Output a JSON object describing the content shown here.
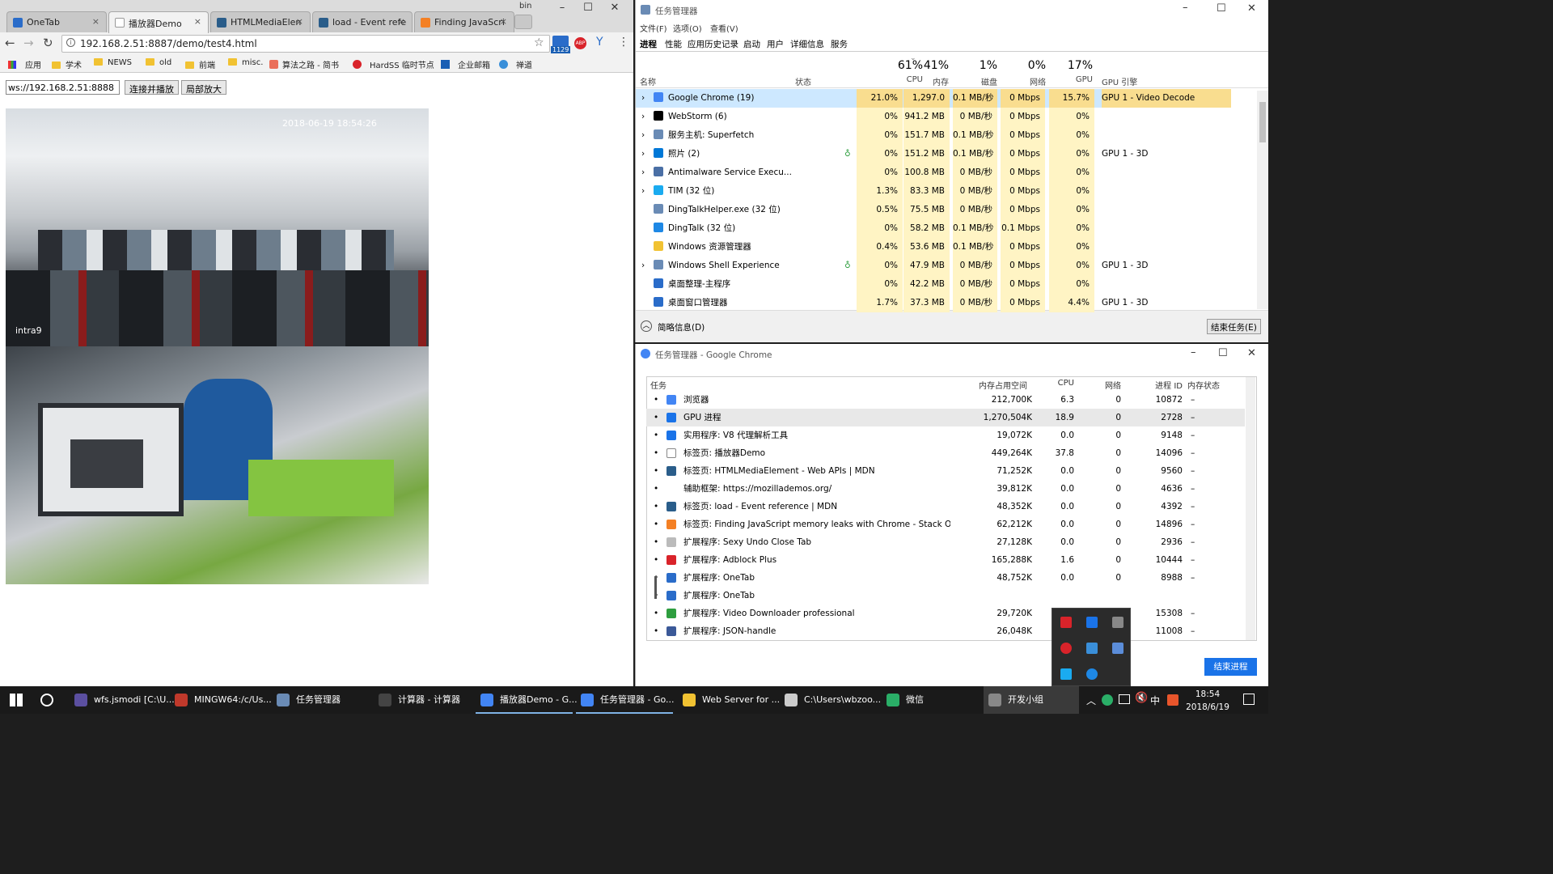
{
  "chrome": {
    "tabs": [
      {
        "label": "OneTab",
        "color": "#2a6cc9",
        "active": false
      },
      {
        "label": "播放器Demo",
        "color": "#ffffff",
        "active": true
      },
      {
        "label": "HTMLMediaElen",
        "color": "#2a5d8a",
        "active": false
      },
      {
        "label": "load - Event refe",
        "color": "#2a5d8a",
        "active": false
      },
      {
        "label": "Finding JavaScri",
        "color": "#f48024",
        "active": false
      }
    ],
    "profile_label": "bin",
    "address": "192.168.2.51:8887/demo/test4.html",
    "ext_badge": "1129",
    "bookmarks": [
      "应用",
      "学术",
      "NEWS",
      "old",
      "前端",
      "misc.",
      "算法之路 - 简书",
      "HardSS 临时节点",
      "企业邮箱",
      "禅道"
    ]
  },
  "page": {
    "ws_value": "ws://192.168.2.51:8888",
    "connect_button": "连接并播放",
    "zoom_button": "局部放大",
    "video_timestamp": "2018-06-19 18:54:26",
    "video_label": "intra9"
  },
  "taskmgr": {
    "title": "任务管理器",
    "menu": [
      "文件(F)",
      "选项(O)",
      "查看(V)"
    ],
    "tabs": [
      "进程",
      "性能",
      "应用历史记录",
      "启动",
      "用户",
      "详细信息",
      "服务"
    ],
    "summary": {
      "cpu": "61%",
      "mem": "41%",
      "disk": "1%",
      "net": "0%",
      "gpu": "17%"
    },
    "headers": {
      "name": "名称",
      "status": "状态",
      "cpu": "CPU",
      "mem": "内存",
      "disk": "磁盘",
      "net": "网络",
      "gpu": "GPU",
      "engine": "GPU 引擎"
    },
    "rows": [
      {
        "name": "Google Chrome (19)",
        "cpu": "21.0%",
        "mem": "1,297.0",
        "disk": "0.1 MB/秒",
        "net": "0 Mbps",
        "gpu": "15.7%",
        "engine": "GPU 1 - Video Decode",
        "color": "#4285f4",
        "expand": true,
        "leaf": false
      },
      {
        "name": "WebStorm (6)",
        "cpu": "0%",
        "mem": "941.2 MB",
        "disk": "0 MB/秒",
        "net": "0 Mbps",
        "gpu": "0%",
        "engine": "",
        "color": "#000000",
        "expand": true,
        "leaf": false
      },
      {
        "name": "服务主机: Superfetch",
        "cpu": "0%",
        "mem": "151.7 MB",
        "disk": "0.1 MB/秒",
        "net": "0 Mbps",
        "gpu": "0%",
        "engine": "",
        "color": "#6a8bb5",
        "expand": true,
        "leaf": false
      },
      {
        "name": "照片 (2)",
        "cpu": "0%",
        "mem": "151.2 MB",
        "disk": "0.1 MB/秒",
        "net": "0 Mbps",
        "gpu": "0%",
        "engine": "GPU 1 - 3D",
        "color": "#0078d7",
        "expand": true,
        "leaf": true
      },
      {
        "name": "Antimalware Service Execu...",
        "cpu": "0%",
        "mem": "100.8 MB",
        "disk": "0 MB/秒",
        "net": "0 Mbps",
        "gpu": "0%",
        "engine": "",
        "color": "#4a6fa5",
        "expand": true,
        "leaf": false
      },
      {
        "name": "TIM (32 位)",
        "cpu": "1.3%",
        "mem": "83.3 MB",
        "disk": "0 MB/秒",
        "net": "0 Mbps",
        "gpu": "0%",
        "engine": "",
        "color": "#1aabf0",
        "expand": true,
        "leaf": false
      },
      {
        "name": "DingTalkHelper.exe (32 位)",
        "cpu": "0.5%",
        "mem": "75.5 MB",
        "disk": "0 MB/秒",
        "net": "0 Mbps",
        "gpu": "0%",
        "engine": "",
        "color": "#6a8bb5",
        "expand": false,
        "leaf": false
      },
      {
        "name": "DingTalk (32 位)",
        "cpu": "0%",
        "mem": "58.2 MB",
        "disk": "0.1 MB/秒",
        "net": "0.1 Mbps",
        "gpu": "0%",
        "engine": "",
        "color": "#1e88e5",
        "expand": false,
        "leaf": false
      },
      {
        "name": "Windows 资源管理器",
        "cpu": "0.4%",
        "mem": "53.6 MB",
        "disk": "0.1 MB/秒",
        "net": "0 Mbps",
        "gpu": "0%",
        "engine": "",
        "color": "#f1c232",
        "expand": false,
        "leaf": false
      },
      {
        "name": "Windows Shell Experience",
        "cpu": "0%",
        "mem": "47.9 MB",
        "disk": "0 MB/秒",
        "net": "0 Mbps",
        "gpu": "0%",
        "engine": "GPU 1 - 3D",
        "color": "#6a8bb5",
        "expand": true,
        "leaf": true
      },
      {
        "name": "桌面整理-主程序",
        "cpu": "0%",
        "mem": "42.2 MB",
        "disk": "0 MB/秒",
        "net": "0 Mbps",
        "gpu": "0%",
        "engine": "",
        "color": "#2a6cc9",
        "expand": false,
        "leaf": false
      },
      {
        "name": "桌面窗口管理器",
        "cpu": "1.7%",
        "mem": "37.3 MB",
        "disk": "0 MB/秒",
        "net": "0 Mbps",
        "gpu": "4.4%",
        "engine": "GPU 1 - 3D",
        "color": "#2a6cc9",
        "expand": false,
        "leaf": false
      }
    ],
    "less_details": "简略信息(D)",
    "end_task": "结束任务(E)"
  },
  "chrome_taskmgr": {
    "title": "任务管理器 - Google Chrome",
    "headers": {
      "task": "任务",
      "mem": "内存占用空间",
      "cpu": "CPU",
      "net": "网络",
      "pid": "进程 ID",
      "memstate": "内存状态"
    },
    "rows": [
      {
        "task": "浏览器",
        "mem": "212,700K",
        "cpu": "6.3",
        "net": "0",
        "pid": "10872",
        "state": "–",
        "color": "#4285f4"
      },
      {
        "task": "GPU 进程",
        "mem": "1,270,504K",
        "cpu": "18.9",
        "net": "0",
        "pid": "2728",
        "state": "–",
        "color": "#1a73e8"
      },
      {
        "task": "实用程序: V8 代理解析工具",
        "mem": "19,072K",
        "cpu": "0.0",
        "net": "0",
        "pid": "9148",
        "state": "–",
        "color": "#1a73e8"
      },
      {
        "task": "标签页: 播放器Demo",
        "mem": "449,264K",
        "cpu": "37.8",
        "net": "0",
        "pid": "14096",
        "state": "–",
        "color": "#ffffff"
      },
      {
        "task": "标签页: HTMLMediaElement - Web APIs | MDN",
        "mem": "71,252K",
        "cpu": "0.0",
        "net": "0",
        "pid": "9560",
        "state": "–",
        "color": "#2a5d8a"
      },
      {
        "task": "辅助框架: https://mozillademos.org/",
        "mem": "39,812K",
        "cpu": "0.0",
        "net": "0",
        "pid": "4636",
        "state": "–",
        "color": ""
      },
      {
        "task": "标签页: load - Event reference | MDN",
        "mem": "48,352K",
        "cpu": "0.0",
        "net": "0",
        "pid": "4392",
        "state": "–",
        "color": "#2a5d8a"
      },
      {
        "task": "标签页: Finding JavaScript memory leaks with Chrome - Stack Overfl...",
        "mem": "62,212K",
        "cpu": "0.0",
        "net": "0",
        "pid": "14896",
        "state": "–",
        "color": "#f48024"
      },
      {
        "task": "扩展程序: Sexy Undo Close Tab",
        "mem": "27,128K",
        "cpu": "0.0",
        "net": "0",
        "pid": "2936",
        "state": "–",
        "color": "#bbbbbb"
      },
      {
        "task": "扩展程序: Adblock Plus",
        "mem": "165,288K",
        "cpu": "1.6",
        "net": "0",
        "pid": "10444",
        "state": "–",
        "color": "#d9232a"
      },
      {
        "task": "扩展程序: OneTab",
        "mem": "48,752K",
        "cpu": "0.0",
        "net": "0",
        "pid": "8988",
        "state": "–",
        "color": "#2a6cc9"
      },
      {
        "task": "扩展程序: OneTab",
        "mem": "",
        "cpu": "",
        "net": "",
        "pid": "",
        "state": "",
        "color": "#2a6cc9"
      },
      {
        "task": "扩展程序: Video Downloader professional",
        "mem": "29,720K",
        "cpu": "",
        "net": "",
        "pid": "15308",
        "state": "–",
        "color": "#2e9e3f"
      },
      {
        "task": "扩展程序: JSON-handle",
        "mem": "26,048K",
        "cpu": "",
        "net": "",
        "pid": "11008",
        "state": "–",
        "color": "#3b5998"
      }
    ],
    "end_process": "结束进程"
  },
  "taskbar": {
    "items": [
      {
        "label": "wfs.jsmodi [C:\\U...",
        "color": "#5b4fa0"
      },
      {
        "label": "MINGW64:/c/Us...",
        "color": "#c0392b"
      },
      {
        "label": "任务管理器",
        "color": "#6a8bb5"
      },
      {
        "label": "计算器 - 计算器",
        "color": "#444444"
      },
      {
        "label": "播放器Demo - G...",
        "color": "#4285f4"
      },
      {
        "label": "任务管理器 - Go...",
        "color": "#4285f4"
      },
      {
        "label": "Web Server for ...",
        "color": "#f1c232"
      },
      {
        "label": "C:\\Users\\wbzoo...",
        "color": "#cccccc"
      },
      {
        "label": "微信",
        "color": "#2aae67"
      },
      {
        "label": "开发小组",
        "color": "#888888"
      }
    ],
    "ime": "中",
    "time": "18:54",
    "date": "2018/6/19"
  }
}
